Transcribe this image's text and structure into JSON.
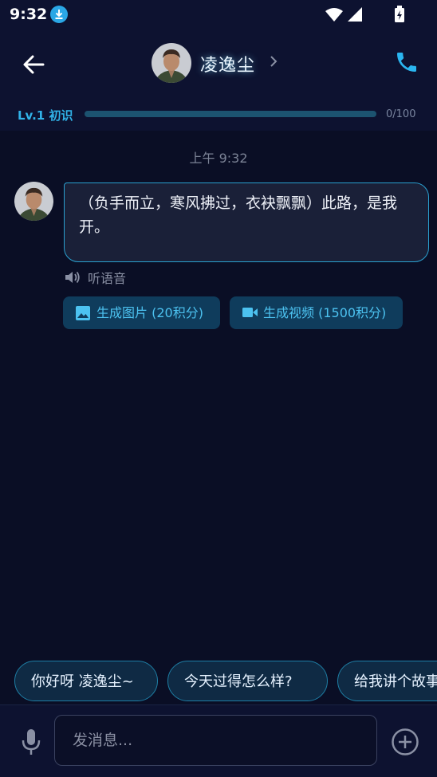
{
  "status": {
    "time": "9:32"
  },
  "header": {
    "name": "凌逸尘"
  },
  "level": {
    "label": "Lv.1 初识",
    "progress_text": "0/100",
    "progress_fraction": 0.0
  },
  "chat": {
    "time_label": "上午 9:32",
    "message": "（负手而立，寒风拂过，衣袂飘飘）此路，是我开。",
    "listen_label": "听语音",
    "gen_image_label": "生成图片 (20积分)",
    "gen_video_label": "生成视频 (1500积分)"
  },
  "suggestions": [
    "你好呀 凌逸尘~",
    "今天过得怎么样?",
    "给我讲个故事"
  ],
  "input": {
    "placeholder": "发消息..."
  },
  "colors": {
    "accent": "#2ab5f0",
    "background": "#0a0e25",
    "bubble_border": "#2aa0d0"
  }
}
